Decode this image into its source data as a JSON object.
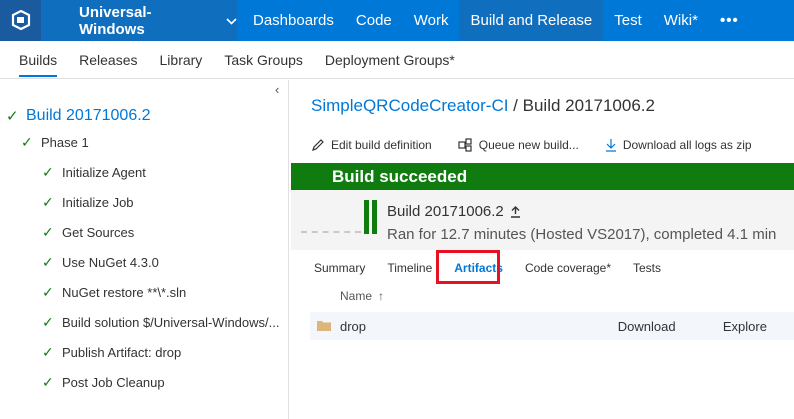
{
  "topnav": {
    "project": "Universal-Windows",
    "items": [
      {
        "label": "Dashboards"
      },
      {
        "label": "Code"
      },
      {
        "label": "Work"
      },
      {
        "label": "Build and Release"
      },
      {
        "label": "Test"
      },
      {
        "label": "Wiki*"
      },
      {
        "label": "•••"
      }
    ]
  },
  "subnav": {
    "items": [
      {
        "label": "Builds"
      },
      {
        "label": "Releases"
      },
      {
        "label": "Library"
      },
      {
        "label": "Task Groups"
      },
      {
        "label": "Deployment Groups*"
      }
    ]
  },
  "tree": {
    "collapse_glyph": "‹",
    "build": "Build 20171006.2",
    "phase": "Phase 1",
    "tasks": [
      "Initialize Agent",
      "Initialize Job",
      "Get Sources",
      "Use NuGet 4.3.0",
      "NuGet restore **\\*.sln",
      "Build solution $/Universal-Windows/...",
      "Publish Artifact: drop",
      "Post Job Cleanup"
    ]
  },
  "breadcrumb": {
    "definition": "SimpleQRCodeCreator-CI",
    "separator": " / ",
    "build": "Build 20171006.2"
  },
  "toolbar": {
    "edit": "Edit build definition",
    "queue": "Queue new build...",
    "download": "Download all logs as zip"
  },
  "banner": {
    "text": "Build succeeded",
    "color": "#107c10"
  },
  "summary": {
    "title": "Build 20171006.2",
    "subtitle": "Ran for 12.7 minutes (Hosted VS2017), completed 4.1 min"
  },
  "tabs": [
    {
      "label": "Summary"
    },
    {
      "label": "Timeline"
    },
    {
      "label": "Artifacts"
    },
    {
      "label": "Code coverage*"
    },
    {
      "label": "Tests"
    }
  ],
  "artifacts": {
    "column_name": "Name",
    "sort_glyph": "↑",
    "rows": [
      {
        "name": "drop",
        "download": "Download",
        "explore": "Explore"
      }
    ]
  },
  "colors": {
    "accent": "#0078d7",
    "success": "#107c10",
    "highlight": "#e81123"
  }
}
